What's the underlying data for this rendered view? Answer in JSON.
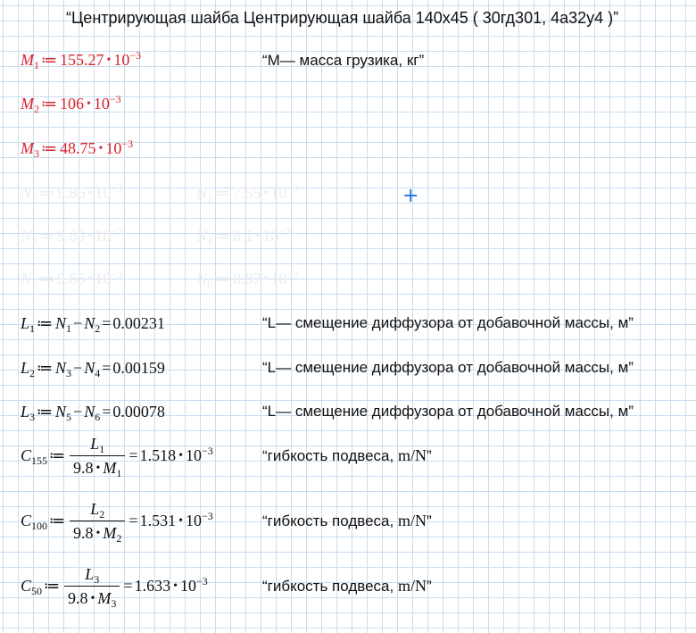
{
  "title": "“Центрирующая шайба Центрирующая шайба 140х45 ( 30гд301, 4а32у4 )”",
  "masses": [
    {
      "sym": "M",
      "sub": "1",
      "value": "155.27",
      "base": "10",
      "exp": "−3"
    },
    {
      "sym": "M",
      "sub": "2",
      "value": "106",
      "base": "10",
      "exp": "−3"
    },
    {
      "sym": "M",
      "sub": "3",
      "value": "48.75",
      "base": "10",
      "exp": "−3"
    }
  ],
  "mass_comment": "“M— масса грузика, кг”",
  "n_values": [
    {
      "sym": "N",
      "sub": "1",
      "value": "9.86",
      "base": "10",
      "exp": "−3"
    },
    {
      "sym": "N",
      "sub": "2",
      "value": "7.55",
      "base": "10",
      "exp": "−3"
    },
    {
      "sym": "N",
      "sub": "3",
      "value": "9.69",
      "base": "10",
      "exp": "−3"
    },
    {
      "sym": "N",
      "sub": "4",
      "value": "8.1",
      "base": "10",
      "exp": "−3"
    },
    {
      "sym": "N",
      "sub": "5",
      "value": "9.65",
      "base": "10",
      "exp": "−3"
    },
    {
      "sym": "N",
      "sub": "6",
      "value": "8.87",
      "base": "10",
      "exp": "−3"
    }
  ],
  "l_rows": [
    {
      "sym": "L",
      "sub": "1",
      "a": "N",
      "asub": "1",
      "b": "N",
      "bsub": "2",
      "result": "0.00231"
    },
    {
      "sym": "L",
      "sub": "2",
      "a": "N",
      "asub": "3",
      "b": "N",
      "bsub": "4",
      "result": "0.00159"
    },
    {
      "sym": "L",
      "sub": "3",
      "a": "N",
      "asub": "5",
      "b": "N",
      "bsub": "6",
      "result": "0.00078"
    }
  ],
  "l_comment": "“L— смещение диффузора от добавочной массы, м”",
  "c_rows": [
    {
      "sym": "C",
      "sub": "155",
      "num": "L",
      "numsub": "1",
      "den_coef": "9.8",
      "den": "M",
      "densub": "1",
      "result": "1.518",
      "base": "10",
      "exp": "−3"
    },
    {
      "sym": "C",
      "sub": "100",
      "num": "L",
      "numsub": "2",
      "den_coef": "9.8",
      "den": "M",
      "densub": "2",
      "result": "1.531",
      "base": "10",
      "exp": "−3"
    },
    {
      "sym": "C",
      "sub": "50",
      "num": "L",
      "numsub": "3",
      "den_coef": "9.8",
      "den": "M",
      "densub": "3",
      "result": "1.633",
      "base": "10",
      "exp": "−3"
    }
  ],
  "c_comment": {
    "prefix": "“гибкость подвеса, ",
    "units": "m/N",
    "suffix": "”"
  },
  "symbols": {
    "define": "≔",
    "equals": "=",
    "minus": "−",
    "dot": "•",
    "cursor": "+"
  }
}
